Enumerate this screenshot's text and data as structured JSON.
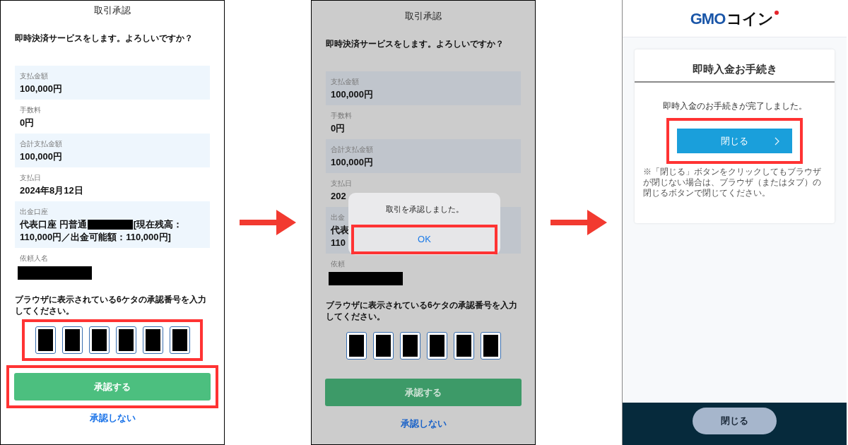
{
  "approval_screen": {
    "title": "取引承認",
    "prompt": "即時決済サービスをします。よろしいですか？",
    "rows": [
      {
        "label": "支払金額",
        "lines": [
          [
            {
              "kind": "text",
              "text": "100,000円"
            }
          ]
        ]
      },
      {
        "label": "手数料",
        "lines": [
          [
            {
              "kind": "text",
              "text": "0円"
            }
          ]
        ]
      },
      {
        "label": "合計支払金額",
        "lines": [
          [
            {
              "kind": "text",
              "text": "100,000円"
            }
          ]
        ]
      },
      {
        "label": "支払日",
        "lines": [
          [
            {
              "kind": "text",
              "text": "2024年8月12日"
            }
          ]
        ]
      },
      {
        "label": "出金口座",
        "lines": [
          [
            {
              "kind": "text",
              "text": "代表口座 円普通"
            },
            {
              "kind": "redaction"
            },
            {
              "kind": "text",
              "text": "[現在残高："
            }
          ],
          [
            {
              "kind": "text",
              "text": "110,000円／出金可能額：110,000円]"
            }
          ]
        ]
      },
      {
        "label": "依頼人名",
        "lines": [
          [
            {
              "kind": "redaction"
            }
          ]
        ]
      }
    ],
    "instruction": "ブラウザに表示されている6ケタの承認番号を入力してください。",
    "code_boxes": [
      {
        "kind": "redaction"
      },
      {
        "kind": "redaction"
      },
      {
        "kind": "redaction"
      },
      {
        "kind": "redaction"
      },
      {
        "kind": "redaction"
      },
      {
        "kind": "redaction"
      }
    ],
    "code_highlighted": true,
    "approve_button": {
      "label": "承認する",
      "highlighted": true
    },
    "decline_link": "承認しない"
  },
  "dialog_screen": {
    "title": "取引承認",
    "prompt": "即時決済サービスをします。よろしいですか？",
    "rows": [
      {
        "label": "支払金額",
        "lines": [
          [
            {
              "kind": "text",
              "text": "100,000円"
            }
          ]
        ]
      },
      {
        "label": "手数料",
        "lines": [
          [
            {
              "kind": "text",
              "text": "0円"
            }
          ]
        ]
      },
      {
        "label": "合計支払金額",
        "lines": [
          [
            {
              "kind": "text",
              "text": "100,000円"
            }
          ]
        ]
      },
      {
        "label": "支払日",
        "lines": [
          [
            {
              "kind": "text",
              "text": "202"
            }
          ]
        ]
      },
      {
        "label": "出金",
        "lines": [
          [
            {
              "kind": "text",
              "text": "代表"
            }
          ],
          [
            {
              "kind": "text",
              "text": "110"
            }
          ]
        ]
      },
      {
        "label": "依頼",
        "lines": [
          [
            {
              "kind": "redaction"
            }
          ]
        ]
      }
    ],
    "instruction": "ブラウザに表示されている6ケタの承認番号を入力してください。",
    "code_boxes": [
      {
        "kind": "redaction"
      },
      {
        "kind": "redaction"
      },
      {
        "kind": "redaction"
      },
      {
        "kind": "redaction"
      },
      {
        "kind": "redaction"
      },
      {
        "kind": "redaction"
      }
    ],
    "code_highlighted": false,
    "approve_button": {
      "label": "承認する",
      "highlighted": false
    },
    "decline_link": "承認しない",
    "dialog": {
      "message": "取引を承認しました。",
      "ok_button": {
        "label": "OK",
        "highlighted": true
      }
    }
  },
  "completion_screen": {
    "logo": {
      "part1": "GMO",
      "part2": "コイン"
    },
    "card_title": "即時入金お手続き",
    "message": "即時入金のお手続きが完了しました。",
    "close_button": {
      "label": "閉じる",
      "highlighted": true
    },
    "note": "※「閉じる」ボタンをクリックしてもブラウザが閉じない場合は、ブラウザ（またはタブ）の閉じるボタンで閉じてください。",
    "footer_button": "閉じる"
  }
}
